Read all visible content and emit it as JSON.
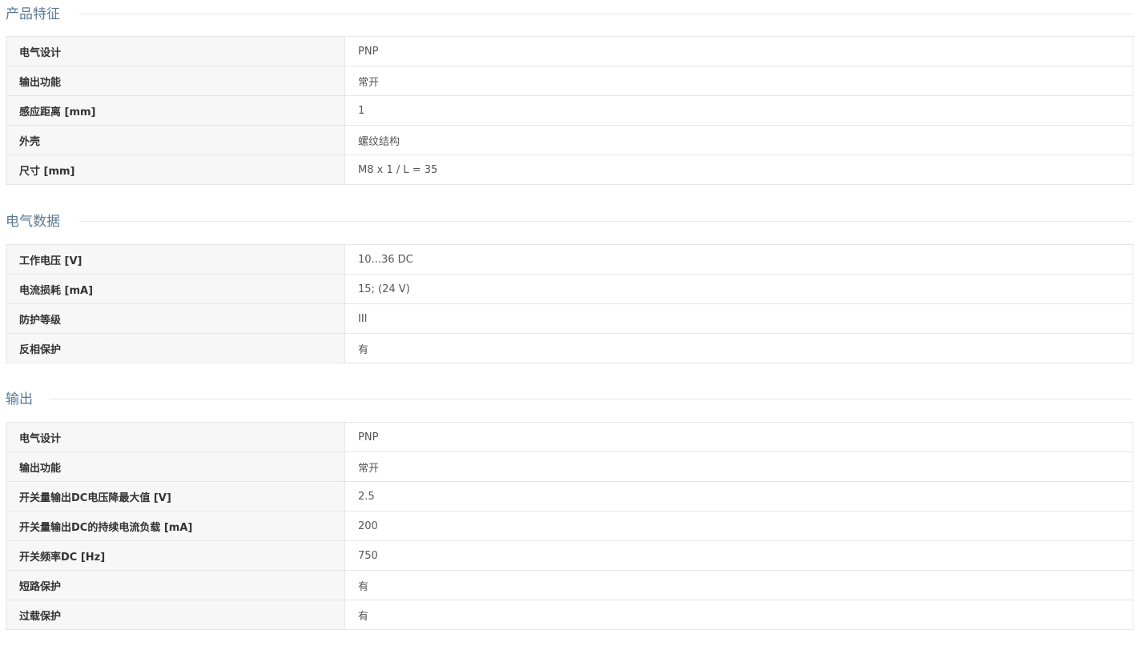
{
  "sections": [
    {
      "title": "产品特征",
      "rows": [
        {
          "label": "电气设计",
          "value": "PNP"
        },
        {
          "label": "输出功能",
          "value": "常开"
        },
        {
          "label": "感应距离 [mm]",
          "value": "1"
        },
        {
          "label": "外壳",
          "value": "螺纹结构"
        },
        {
          "label": "尺寸 [mm]",
          "value": "M8 x 1 / L = 35"
        }
      ]
    },
    {
      "title": "电气数据",
      "rows": [
        {
          "label": "工作电压 [V]",
          "value": "10...36 DC"
        },
        {
          "label": "电流损耗 [mA]",
          "value": "15; (24 V)"
        },
        {
          "label": "防护等级",
          "value": "III"
        },
        {
          "label": "反相保护",
          "value": "有"
        }
      ]
    },
    {
      "title": "输出",
      "rows": [
        {
          "label": "电气设计",
          "value": "PNP"
        },
        {
          "label": "输出功能",
          "value": "常开"
        },
        {
          "label": "开关量输出DC电压降最大值 [V]",
          "value": "2.5"
        },
        {
          "label": "开关量输出DC的持续电流负载 [mA]",
          "value": "200"
        },
        {
          "label": "开关频率DC [Hz]",
          "value": "750"
        },
        {
          "label": "短路保护",
          "value": "有"
        },
        {
          "label": "过载保护",
          "value": "有"
        }
      ]
    }
  ]
}
